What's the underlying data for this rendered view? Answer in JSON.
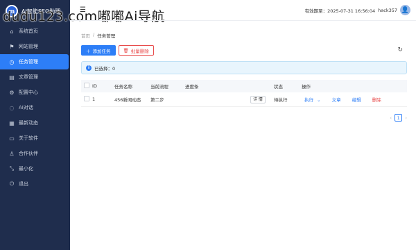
{
  "brand": {
    "logo_text": "m",
    "title": "AI智能SEO助理"
  },
  "watermark": "dudu123.com嘟嘟Ai导航",
  "sidebar": {
    "items": [
      {
        "icon": "home-icon",
        "glyph": "⌂",
        "label": "系统首页"
      },
      {
        "icon": "flag-icon",
        "glyph": "⚑",
        "label": "网站管理"
      },
      {
        "icon": "clock-icon",
        "glyph": "◷",
        "label": "任务管理",
        "active": true
      },
      {
        "icon": "document-icon",
        "glyph": "▤",
        "label": "文章管理"
      },
      {
        "icon": "gear-icon",
        "glyph": "⚙",
        "label": "配置中心"
      },
      {
        "icon": "chat-icon",
        "glyph": "◌",
        "label": "AI对话"
      },
      {
        "icon": "news-icon",
        "glyph": "▦",
        "label": "最新动态"
      },
      {
        "icon": "monitor-icon",
        "glyph": "▭",
        "label": "关于软件"
      },
      {
        "icon": "partner-icon",
        "glyph": "♙",
        "label": "合作伙伴"
      },
      {
        "icon": "minimize-icon",
        "glyph": "⤡",
        "label": "最小化"
      },
      {
        "icon": "exit-icon",
        "glyph": "⏻",
        "label": "退出"
      }
    ]
  },
  "header": {
    "menu_glyph": "☰",
    "expiry": "有效期至：2025-07-31 16:56:04",
    "username": "hack357",
    "avatar_glyph": "👤"
  },
  "breadcrumb": {
    "home": "首页",
    "separator": "/",
    "current": "任务管理"
  },
  "toolbar": {
    "add_label": "添加任务",
    "batch_delete_label": "批量删除",
    "refresh_glyph": "↻"
  },
  "alert": {
    "text": "已选择：0"
  },
  "table": {
    "headers": [
      "ID",
      "任务名称",
      "当前流程",
      "进度条",
      "状态",
      "操作"
    ],
    "rows": [
      {
        "id": "1",
        "name": "456新闻动态",
        "flow": "第二步",
        "progress": "",
        "detail_label": "详 情",
        "status": "待执行",
        "actions": {
          "execute": "执行",
          "article": "文章",
          "edit": "编辑",
          "delete": "删除"
        }
      }
    ]
  },
  "pagination": {
    "prev": "‹",
    "page": "1",
    "next": "›"
  },
  "colors": {
    "sidebar_bg": "#1f2d4d",
    "accent": "#2d7ef7",
    "danger": "#e84b4b"
  }
}
